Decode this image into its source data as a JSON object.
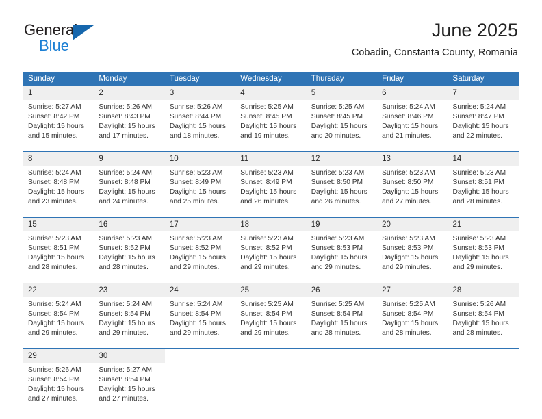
{
  "brand": {
    "name_part1": "General",
    "name_part2": "Blue",
    "accent_color": "#1b7fd4",
    "triangle_color": "#1667ad",
    "logo_icon": "triangle-flag-icon"
  },
  "header": {
    "title": "June 2025",
    "subtitle": "Cobadin, Constanta County, Romania"
  },
  "theme": {
    "header_bg": "#2f74b5",
    "header_text": "#ffffff",
    "daynum_bg": "#efefef",
    "cell_bg": "#ffffff",
    "separator": "#2f74b5"
  },
  "calendar": {
    "weekday_headers": [
      "Sunday",
      "Monday",
      "Tuesday",
      "Wednesday",
      "Thursday",
      "Friday",
      "Saturday"
    ],
    "weeks": [
      [
        {
          "day": "1",
          "sunrise": "Sunrise: 5:27 AM",
          "sunset": "Sunset: 8:42 PM",
          "daylight1": "Daylight: 15 hours",
          "daylight2": "and 15 minutes."
        },
        {
          "day": "2",
          "sunrise": "Sunrise: 5:26 AM",
          "sunset": "Sunset: 8:43 PM",
          "daylight1": "Daylight: 15 hours",
          "daylight2": "and 17 minutes."
        },
        {
          "day": "3",
          "sunrise": "Sunrise: 5:26 AM",
          "sunset": "Sunset: 8:44 PM",
          "daylight1": "Daylight: 15 hours",
          "daylight2": "and 18 minutes."
        },
        {
          "day": "4",
          "sunrise": "Sunrise: 5:25 AM",
          "sunset": "Sunset: 8:45 PM",
          "daylight1": "Daylight: 15 hours",
          "daylight2": "and 19 minutes."
        },
        {
          "day": "5",
          "sunrise": "Sunrise: 5:25 AM",
          "sunset": "Sunset: 8:45 PM",
          "daylight1": "Daylight: 15 hours",
          "daylight2": "and 20 minutes."
        },
        {
          "day": "6",
          "sunrise": "Sunrise: 5:24 AM",
          "sunset": "Sunset: 8:46 PM",
          "daylight1": "Daylight: 15 hours",
          "daylight2": "and 21 minutes."
        },
        {
          "day": "7",
          "sunrise": "Sunrise: 5:24 AM",
          "sunset": "Sunset: 8:47 PM",
          "daylight1": "Daylight: 15 hours",
          "daylight2": "and 22 minutes."
        }
      ],
      [
        {
          "day": "8",
          "sunrise": "Sunrise: 5:24 AM",
          "sunset": "Sunset: 8:48 PM",
          "daylight1": "Daylight: 15 hours",
          "daylight2": "and 23 minutes."
        },
        {
          "day": "9",
          "sunrise": "Sunrise: 5:24 AM",
          "sunset": "Sunset: 8:48 PM",
          "daylight1": "Daylight: 15 hours",
          "daylight2": "and 24 minutes."
        },
        {
          "day": "10",
          "sunrise": "Sunrise: 5:23 AM",
          "sunset": "Sunset: 8:49 PM",
          "daylight1": "Daylight: 15 hours",
          "daylight2": "and 25 minutes."
        },
        {
          "day": "11",
          "sunrise": "Sunrise: 5:23 AM",
          "sunset": "Sunset: 8:49 PM",
          "daylight1": "Daylight: 15 hours",
          "daylight2": "and 26 minutes."
        },
        {
          "day": "12",
          "sunrise": "Sunrise: 5:23 AM",
          "sunset": "Sunset: 8:50 PM",
          "daylight1": "Daylight: 15 hours",
          "daylight2": "and 26 minutes."
        },
        {
          "day": "13",
          "sunrise": "Sunrise: 5:23 AM",
          "sunset": "Sunset: 8:50 PM",
          "daylight1": "Daylight: 15 hours",
          "daylight2": "and 27 minutes."
        },
        {
          "day": "14",
          "sunrise": "Sunrise: 5:23 AM",
          "sunset": "Sunset: 8:51 PM",
          "daylight1": "Daylight: 15 hours",
          "daylight2": "and 28 minutes."
        }
      ],
      [
        {
          "day": "15",
          "sunrise": "Sunrise: 5:23 AM",
          "sunset": "Sunset: 8:51 PM",
          "daylight1": "Daylight: 15 hours",
          "daylight2": "and 28 minutes."
        },
        {
          "day": "16",
          "sunrise": "Sunrise: 5:23 AM",
          "sunset": "Sunset: 8:52 PM",
          "daylight1": "Daylight: 15 hours",
          "daylight2": "and 28 minutes."
        },
        {
          "day": "17",
          "sunrise": "Sunrise: 5:23 AM",
          "sunset": "Sunset: 8:52 PM",
          "daylight1": "Daylight: 15 hours",
          "daylight2": "and 29 minutes."
        },
        {
          "day": "18",
          "sunrise": "Sunrise: 5:23 AM",
          "sunset": "Sunset: 8:52 PM",
          "daylight1": "Daylight: 15 hours",
          "daylight2": "and 29 minutes."
        },
        {
          "day": "19",
          "sunrise": "Sunrise: 5:23 AM",
          "sunset": "Sunset: 8:53 PM",
          "daylight1": "Daylight: 15 hours",
          "daylight2": "and 29 minutes."
        },
        {
          "day": "20",
          "sunrise": "Sunrise: 5:23 AM",
          "sunset": "Sunset: 8:53 PM",
          "daylight1": "Daylight: 15 hours",
          "daylight2": "and 29 minutes."
        },
        {
          "day": "21",
          "sunrise": "Sunrise: 5:23 AM",
          "sunset": "Sunset: 8:53 PM",
          "daylight1": "Daylight: 15 hours",
          "daylight2": "and 29 minutes."
        }
      ],
      [
        {
          "day": "22",
          "sunrise": "Sunrise: 5:24 AM",
          "sunset": "Sunset: 8:54 PM",
          "daylight1": "Daylight: 15 hours",
          "daylight2": "and 29 minutes."
        },
        {
          "day": "23",
          "sunrise": "Sunrise: 5:24 AM",
          "sunset": "Sunset: 8:54 PM",
          "daylight1": "Daylight: 15 hours",
          "daylight2": "and 29 minutes."
        },
        {
          "day": "24",
          "sunrise": "Sunrise: 5:24 AM",
          "sunset": "Sunset: 8:54 PM",
          "daylight1": "Daylight: 15 hours",
          "daylight2": "and 29 minutes."
        },
        {
          "day": "25",
          "sunrise": "Sunrise: 5:25 AM",
          "sunset": "Sunset: 8:54 PM",
          "daylight1": "Daylight: 15 hours",
          "daylight2": "and 29 minutes."
        },
        {
          "day": "26",
          "sunrise": "Sunrise: 5:25 AM",
          "sunset": "Sunset: 8:54 PM",
          "daylight1": "Daylight: 15 hours",
          "daylight2": "and 28 minutes."
        },
        {
          "day": "27",
          "sunrise": "Sunrise: 5:25 AM",
          "sunset": "Sunset: 8:54 PM",
          "daylight1": "Daylight: 15 hours",
          "daylight2": "and 28 minutes."
        },
        {
          "day": "28",
          "sunrise": "Sunrise: 5:26 AM",
          "sunset": "Sunset: 8:54 PM",
          "daylight1": "Daylight: 15 hours",
          "daylight2": "and 28 minutes."
        }
      ],
      [
        {
          "day": "29",
          "sunrise": "Sunrise: 5:26 AM",
          "sunset": "Sunset: 8:54 PM",
          "daylight1": "Daylight: 15 hours",
          "daylight2": "and 27 minutes."
        },
        {
          "day": "30",
          "sunrise": "Sunrise: 5:27 AM",
          "sunset": "Sunset: 8:54 PM",
          "daylight1": "Daylight: 15 hours",
          "daylight2": "and 27 minutes."
        },
        {
          "day": "",
          "sunrise": "",
          "sunset": "",
          "daylight1": "",
          "daylight2": ""
        },
        {
          "day": "",
          "sunrise": "",
          "sunset": "",
          "daylight1": "",
          "daylight2": ""
        },
        {
          "day": "",
          "sunrise": "",
          "sunset": "",
          "daylight1": "",
          "daylight2": ""
        },
        {
          "day": "",
          "sunrise": "",
          "sunset": "",
          "daylight1": "",
          "daylight2": ""
        },
        {
          "day": "",
          "sunrise": "",
          "sunset": "",
          "daylight1": "",
          "daylight2": ""
        }
      ]
    ]
  }
}
